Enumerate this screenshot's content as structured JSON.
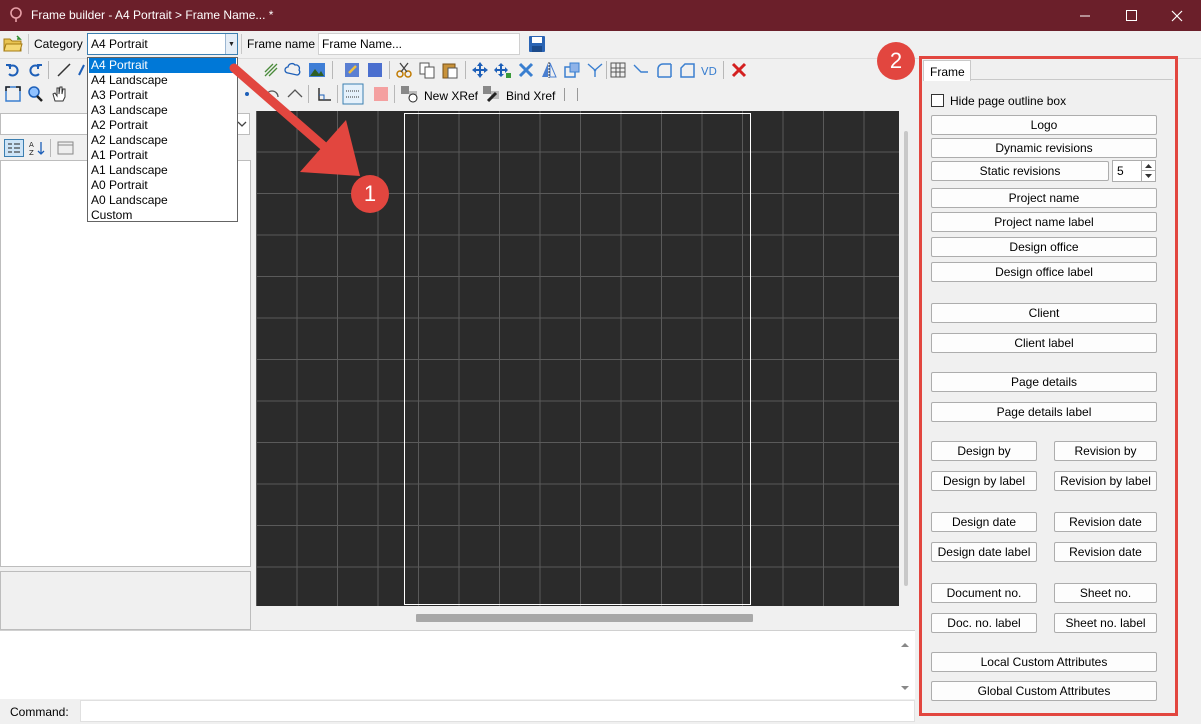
{
  "window": {
    "title": "Frame builder - A4 Portrait > Frame Name... *"
  },
  "row1": {
    "category_label": "Category",
    "category_value": "A4 Portrait",
    "frame_name_label": "Frame name",
    "frame_name_value": "Frame Name..."
  },
  "toolbar": {
    "new_xref_label": "New XRef",
    "bind_xref_label": "Bind Xref"
  },
  "dropdown": {
    "options": [
      "A4 Portrait",
      "A4 Landscape",
      "A3 Portrait",
      "A3 Landscape",
      "A2 Portrait",
      "A2 Landscape",
      "A1 Portrait",
      "A1 Landscape",
      "A0 Portrait",
      "A0 Landscape",
      "Custom"
    ],
    "selected": "A4 Portrait"
  },
  "frame_panel": {
    "tab_label": "Frame",
    "hide_outline_label": "Hide page outline box",
    "hide_outline_checked": false,
    "static_revisions_count": "5",
    "buttons": {
      "logo": "Logo",
      "dynamic_revisions": "Dynamic revisions",
      "static_revisions": "Static revisions",
      "project_name": "Project name",
      "project_name_label": "Project name label",
      "design_office": "Design office",
      "design_office_label": "Design office label",
      "client": "Client",
      "client_label": "Client label",
      "page_details": "Page details",
      "page_details_label": "Page details label",
      "design_by": "Design by",
      "revision_by": "Revision by",
      "design_by_label": "Design by label",
      "revision_by_label": "Revision by label",
      "design_date": "Design date",
      "revision_date": "Revision date",
      "design_date_label": "Design date label",
      "revision_date_2": "Revision date",
      "document_no": "Document no.",
      "sheet_no": "Sheet no.",
      "doc_no_label": "Doc. no. label",
      "sheet_no_label": "Sheet no. label",
      "local_custom_attributes": "Local Custom Attributes",
      "global_custom_attributes": "Global Custom Attributes"
    }
  },
  "annotations": {
    "badge_1": "1",
    "badge_2": "2"
  },
  "command": {
    "label": "Command:",
    "value": ""
  },
  "colors": {
    "titlebar": "#6b1f2a",
    "annotation": "#e2463f",
    "selection": "#0078d7",
    "canvas": "#2b2b2b"
  }
}
